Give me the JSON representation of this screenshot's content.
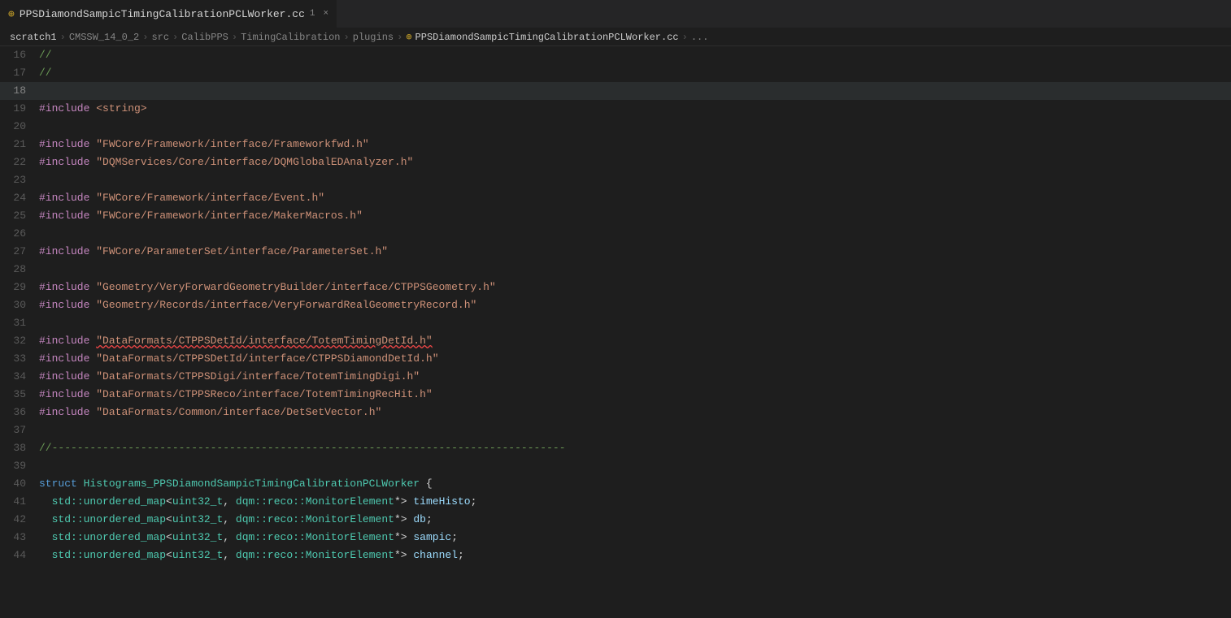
{
  "tab": {
    "icon": "⊕",
    "label": "PPSDiamondSampicTimingCalibrationPCLWorker.cc",
    "number": "1",
    "close": "×"
  },
  "breadcrumb": {
    "items": [
      "scratch1",
      "CMSSW_14_0_2",
      "src",
      "CalibPPS",
      "TimingCalibration",
      "plugins",
      "PPSDiamondSampicTimingCalibrationPCLWorker.cc",
      "..."
    ]
  },
  "lines": [
    {
      "num": "16",
      "content": "//"
    },
    {
      "num": "17",
      "content": "//"
    },
    {
      "num": "18",
      "content": ""
    },
    {
      "num": "19",
      "content": "#include <string>"
    },
    {
      "num": "20",
      "content": ""
    },
    {
      "num": "21",
      "content": "#include \"FWCore/Framework/interface/Frameworkfwd.h\""
    },
    {
      "num": "22",
      "content": "#include \"DQMServices/Core/interface/DQMGlobalEDAnalyzer.h\""
    },
    {
      "num": "23",
      "content": ""
    },
    {
      "num": "24",
      "content": "#include \"FWCore/Framework/interface/Event.h\""
    },
    {
      "num": "25",
      "content": "#include \"FWCore/Framework/interface/MakerMacros.h\""
    },
    {
      "num": "26",
      "content": ""
    },
    {
      "num": "27",
      "content": "#include \"FWCore/ParameterSet/interface/ParameterSet.h\""
    },
    {
      "num": "28",
      "content": ""
    },
    {
      "num": "29",
      "content": "#include \"Geometry/VeryForwardGeometryBuilder/interface/CTPPSGeometry.h\""
    },
    {
      "num": "30",
      "content": "#include \"Geometry/Records/interface/VeryForwardRealGeometryRecord.h\""
    },
    {
      "num": "31",
      "content": ""
    },
    {
      "num": "32",
      "content": "#include \"DataFormats/CTPPSDetId/interface/TotemTimingDetId.h\"",
      "squiggle": true
    },
    {
      "num": "33",
      "content": "#include \"DataFormats/CTPPSDetId/interface/CTPPSDiamondDetId.h\""
    },
    {
      "num": "34",
      "content": "#include \"DataFormats/CTPPSDigi/interface/TotemTimingDigi.h\""
    },
    {
      "num": "35",
      "content": "#include \"DataFormats/CTPPSReco/interface/TotemTimingRecHit.h\""
    },
    {
      "num": "36",
      "content": "#include \"DataFormats/Common/interface/DetSetVector.h\""
    },
    {
      "num": "37",
      "content": ""
    },
    {
      "num": "38",
      "content": "//---------------------------------------------------------------------------------"
    },
    {
      "num": "39",
      "content": ""
    },
    {
      "num": "40",
      "content": "struct Histograms_PPSDiamondSampicTimingCalibrationPCLWorker {"
    },
    {
      "num": "41",
      "content": "  std::unordered_map<uint32_t, dqm::reco::MonitorElement*> timeHisto;"
    },
    {
      "num": "42",
      "content": "  std::unordered_map<uint32_t, dqm::reco::MonitorElement*> db;"
    },
    {
      "num": "43",
      "content": "  std::unordered_map<uint32_t, dqm::reco::MonitorElement*> sampic;"
    },
    {
      "num": "44",
      "content": "  std::unordered_map<uint32_t, dqm::reco::MonitorElement*> channel;"
    }
  ]
}
